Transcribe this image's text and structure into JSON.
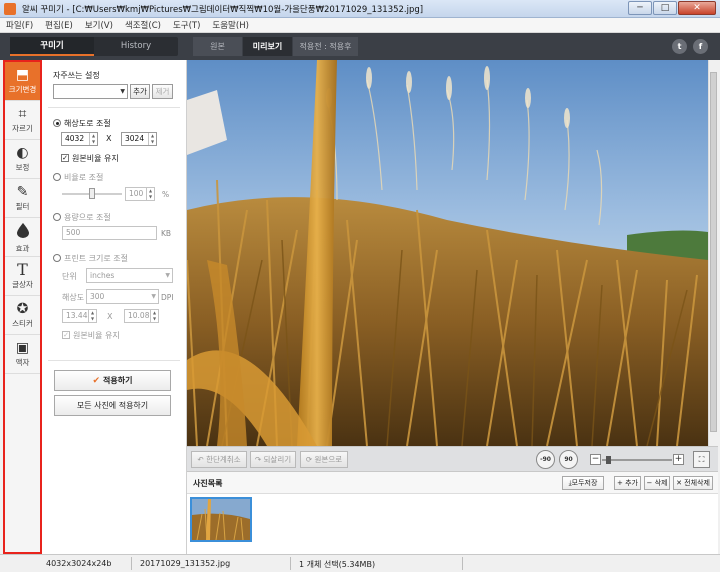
{
  "window": {
    "title": "알씨 꾸미기 - [C:₩Users₩kmj₩Pictures₩그림데이터₩직찍₩10월-가을단풍₩20171029_131352.jpg]",
    "minimize": "─",
    "maximize": "□",
    "close": "✕"
  },
  "menu": [
    "파일(F)",
    "편집(E)",
    "보기(V)",
    "색조절(C)",
    "도구(T)",
    "도움말(H)"
  ],
  "header": {
    "tabs": [
      {
        "label": "꾸미기",
        "active": true
      },
      {
        "label": "History",
        "active": false
      }
    ],
    "view_tabs": [
      {
        "label": "원본",
        "active": false
      },
      {
        "label": "미리보기",
        "active": true
      },
      {
        "label": "적용전 : 적용후",
        "active": false
      }
    ],
    "social": [
      "t",
      "f"
    ]
  },
  "tools": [
    {
      "label": "크기변경",
      "icon": "resize-icon",
      "glyph": "⬒",
      "active": true
    },
    {
      "label": "자르기",
      "icon": "crop-icon",
      "glyph": "⌗",
      "active": false
    },
    {
      "label": "보정",
      "icon": "adjust-icon",
      "glyph": "◐",
      "active": false
    },
    {
      "label": "필터",
      "icon": "filter-wand-icon",
      "glyph": "✎",
      "active": false
    },
    {
      "label": "효과",
      "icon": "drop-icon",
      "glyph": "💧",
      "active": false
    },
    {
      "label": "글상자",
      "icon": "text-icon",
      "glyph": "T",
      "active": false
    },
    {
      "label": "스티커",
      "icon": "sticker-icon",
      "glyph": "✪",
      "active": false
    },
    {
      "label": "액자",
      "icon": "frame-icon",
      "glyph": "▣",
      "active": false
    }
  ],
  "panel": {
    "favorites_title": "자주쓰는 설정",
    "favorites_value": "",
    "add_label": "추가",
    "remove_label": "제거",
    "resolution": {
      "label": "해상도로 조절",
      "width": "4032",
      "x": "X",
      "height": "3024",
      "keep_ratio": "원본비율 유지"
    },
    "ratio": {
      "label": "비율로 조절",
      "value": "100",
      "unit": "%",
      "level": 0.5
    },
    "capacity": {
      "label": "용량으로 조절",
      "value": "500",
      "unit": "KB"
    },
    "print": {
      "label": "프린트 크기로 조절",
      "unit_label": "단위",
      "unit_value": "inches",
      "dpi_label": "해상도",
      "dpi_value": "300",
      "dpi_unit": "DPI",
      "width": "13.44",
      "x": "X",
      "height": "10.08",
      "keep_ratio": "원본비율 유지"
    },
    "apply_label": "적용하기",
    "apply_all_label": "모든 사진에 적용하기"
  },
  "toolbar": {
    "undo_label": "한단계취소",
    "redo_label": "되살리기",
    "original_label": "원본으로",
    "rotate_left": "-90",
    "rotate_right": "90",
    "zoom_minus": "−",
    "zoom_plus": "+",
    "zoom_level": 0.05
  },
  "photo_list": {
    "title": "사진목록",
    "save_all_label": "모두저장",
    "add_label": "+ 추가",
    "delete_label": "− 삭제",
    "delete_all_label": "✕ 전체삭제"
  },
  "status": {
    "dimensions": "4032x3024x24b",
    "filename": "20171029_131352.jpg",
    "selection": "1 개체 선택(5.34MB)"
  }
}
